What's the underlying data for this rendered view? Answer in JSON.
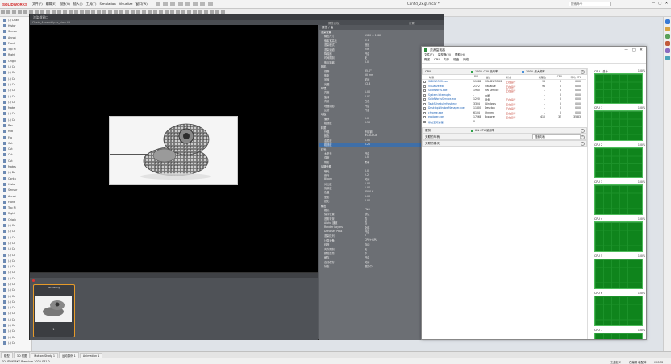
{
  "app": {
    "logo": "SOLIDWORKS",
    "menus": [
      "文件(F)",
      "编辑(E)",
      "视图(V)",
      "插入(I)",
      "工具(T)",
      "Simulation",
      "Visualize",
      "窗口(W)"
    ],
    "doc_title": "Confid_2x.gt.mcar *",
    "search_placeholder": "搜索命令",
    "window_buttons": [
      "—",
      "▢",
      "✕"
    ]
  },
  "tree": {
    "rows": [
      "(-) Chain",
      "Histor",
      "Sensor",
      "Annot",
      "Front",
      "Top Pl",
      "Right",
      "Origin",
      "(-) Co",
      "(-) Co",
      "(-) Co",
      "(-) Co",
      "(-) Co",
      "(-) Co",
      "(-) Co",
      "Mate",
      "(-) Co",
      "(-) Co",
      "Bac",
      "Mid",
      "Fro",
      "Cut",
      "Cut",
      "Cut",
      "Cut",
      "Mates",
      "(-) Ba",
      "Conta",
      "Histor",
      "Sensor",
      "Annot",
      "Front",
      "Top Pl",
      "Right",
      "Origin",
      "(-) Co",
      "(-) Co",
      "(-) Co",
      "(-) Co",
      "(-) Co",
      "(-) Co",
      "(-) Co",
      "(-) Co",
      "(-) Co",
      "(-) Co",
      "(-) Co",
      "(-) Co",
      "(-) Co",
      "(-) Co",
      "(-) Co",
      "(-) Co",
      "(-) Co",
      "(-) Co",
      "(-) Co",
      "(-) Co",
      "(-) Co"
    ]
  },
  "render": {
    "title": "渲染器窗口",
    "tab_left": "Chain_Assembly.xx_view.4d",
    "tab_mid": "属性面板",
    "tab_right": "设置",
    "viewport_hint": "",
    "film_label": "Rendering",
    "film_number": "1"
  },
  "props": {
    "header": "属性 / 值",
    "rows": [
      {
        "k": "渲染设置",
        "v": "",
        "sec": true
      },
      {
        "k": "输出尺寸",
        "v": "1920 × 1080"
      },
      {
        "k": "像素宽高比",
        "v": "1:1"
      },
      {
        "k": "渲染模式",
        "v": "快速"
      },
      {
        "k": "渲染通道",
        "v": "256"
      },
      {
        "k": "降噪器",
        "v": "开启"
      },
      {
        "k": "时间限制",
        "v": "无"
      },
      {
        "k": "焦点距离",
        "v": "0.0"
      },
      {
        "k": "相机",
        "v": "",
        "sec": true
      },
      {
        "k": "视野",
        "v": "35.0°"
      },
      {
        "k": "焦距",
        "v": "50 mm"
      },
      {
        "k": "景深",
        "v": "关闭"
      },
      {
        "k": "光圈",
        "v": "f/2.8"
      },
      {
        "k": "环境",
        "v": "",
        "sec": true
      },
      {
        "k": "亮度",
        "v": "1.00"
      },
      {
        "k": "旋转",
        "v": "0.0°"
      },
      {
        "k": "背景",
        "v": "白色"
      },
      {
        "k": "地面阴影",
        "v": "开启"
      },
      {
        "k": "反射",
        "v": "开启"
      },
      {
        "k": "地板",
        "v": "",
        "sec": true
      },
      {
        "k": "偏移",
        "v": "0.0"
      },
      {
        "k": "粗糙度",
        "v": "0.50"
      },
      {
        "k": "材质",
        "v": "",
        "sec": true
      },
      {
        "k": "外观",
        "v": "不锈钢"
      },
      {
        "k": "颜色",
        "v": "#C8C8C8"
      },
      {
        "k": "金属度",
        "v": "1.00"
      },
      {
        "k": "粗糙度",
        "v": "0.20",
        "sel": true
      },
      {
        "k": "灯光",
        "v": "",
        "sec": true
      },
      {
        "k": "太阳光",
        "v": "开启"
      },
      {
        "k": "强度",
        "v": "1.0"
      },
      {
        "k": "阴影",
        "v": "柔和"
      },
      {
        "k": "后期处理",
        "v": "",
        "sec": true
      },
      {
        "k": "曝光",
        "v": "0.0"
      },
      {
        "k": "伽马",
        "v": "2.2"
      },
      {
        "k": "Bloom",
        "v": "关闭"
      },
      {
        "k": "对比度",
        "v": "1.00"
      },
      {
        "k": "饱和度",
        "v": "1.00"
      },
      {
        "k": "色温",
        "v": "6500 K"
      },
      {
        "k": "晕影",
        "v": "0.00"
      },
      {
        "k": "锐化",
        "v": "0.00"
      },
      {
        "k": "输出",
        "v": "",
        "sec": true
      },
      {
        "k": "格式",
        "v": "PNG"
      },
      {
        "k": "保存位置",
        "v": "默认"
      },
      {
        "k": "透明背景",
        "v": "否"
      },
      {
        "k": "Alpha 通道",
        "v": "否"
      },
      {
        "k": "Render Layers",
        "v": "全部"
      },
      {
        "k": "Denoiser Pass",
        "v": "开启"
      },
      {
        "k": "渲染队列",
        "v": "0"
      },
      {
        "k": "计算设备",
        "v": "CPU+GPU"
      },
      {
        "k": "线程",
        "v": "自动"
      },
      {
        "k": "内存限制",
        "v": "无"
      },
      {
        "k": "预览质量",
        "v": "中"
      },
      {
        "k": "缓存",
        "v": "开启"
      },
      {
        "k": "自动保存",
        "v": "关闭"
      },
      {
        "k": "状态",
        "v": "渲染中"
      }
    ]
  },
  "taskmgr": {
    "title": "资源监视器",
    "menus": [
      "文件(F)",
      "监视器(M)",
      "帮助(H)"
    ],
    "tabs": [
      "概述",
      "CPU",
      "内存",
      "磁盘",
      "网络"
    ],
    "cpu_section": "CPU",
    "cpu_usage": "100% CPU 使用率",
    "cpu_freq": "100% 最大频率",
    "columns": [
      "映像",
      "PID",
      "描述",
      "状态",
      "线程数",
      "CPU",
      "平均 CPU"
    ],
    "processes": [
      {
        "name": "SLDWORKS.exe",
        "pid": "11088",
        "user": "SOLIDWORKS",
        "status": "正在运行",
        "a": "96",
        "b": "0",
        "c": "0.00"
      },
      {
        "name": "Visualize.exe",
        "pid": "2172",
        "user": "Visualize",
        "status": "正在运行",
        "a": "96",
        "b": "0",
        "c": "0.00"
      },
      {
        "name": "SolidWorks.exe",
        "pid": "1980",
        "user": "SW Service",
        "status": "正在运行",
        "a": "-",
        "b": "0",
        "c": "0.00"
      },
      {
        "name": "System Interrupts",
        "pid": "-",
        "user": "中断",
        "status": "-",
        "a": "-",
        "b": "0",
        "c": "0.00"
      },
      {
        "name": "SolidWorksService.exe",
        "pid": "1220",
        "user": "服务",
        "status": "正在运行",
        "a": "-",
        "b": "0",
        "c": "0.00"
      },
      {
        "name": "TaskSchedulerHost.exe",
        "pid": "3304",
        "user": "Windows",
        "status": "正在运行",
        "a": "-",
        "b": "0",
        "c": "0.00"
      },
      {
        "name": "DesktopWindowManager.exe",
        "pid": "11800",
        "user": "Desktop",
        "status": "正在运行",
        "a": "-",
        "b": "0",
        "c": "0.00"
      },
      {
        "name": "chrome.exe",
        "pid": "6104",
        "user": "Chrome",
        "status": "正在运行",
        "a": "-",
        "b": "0",
        "c": "0.00"
      },
      {
        "name": "explorer.exe",
        "pid": "17068",
        "user": "Explorer",
        "status": "正在运行",
        "a": "410",
        "b": "35",
        "c": "35.83"
      },
      {
        "name": "系统空闲进程",
        "pid": "0",
        "user": "-",
        "status": "-",
        "a": "-",
        "b": "-",
        "c": "-"
      }
    ],
    "services_section": "服务",
    "services_usage": "0% CPU 使用率",
    "handles_section": "关联的句柄",
    "handles_filter": "搜索句柄",
    "modules_section": "关联的模块",
    "cpus": [
      {
        "label": "CPU - 总计",
        "pct": "100%",
        "load": 0.98
      },
      {
        "label": "CPU 1",
        "pct": "100%",
        "load": 0.97
      },
      {
        "label": "CPU 2",
        "pct": "100%",
        "load": 0.99
      },
      {
        "label": "CPU 3",
        "pct": "100%",
        "load": 0.96
      },
      {
        "label": "CPU 4",
        "pct": "100%",
        "load": 0.98
      },
      {
        "label": "CPU 5",
        "pct": "100%",
        "load": 0.97
      },
      {
        "label": "CPU 6",
        "pct": "100%",
        "load": 0.99
      },
      {
        "label": "CPU 7",
        "pct": "100%",
        "load": 0.98
      }
    ]
  },
  "bottom": {
    "tabs": [
      "模型",
      "3D 视图",
      "Motion Study 1",
      "运动算例 1",
      "Animation 1"
    ],
    "status_left": "SOLIDWORKS Premium 2022 SP1.0",
    "status_right": [
      "完全定义",
      "在编辑 装配体",
      "MMGS"
    ]
  },
  "colors": {
    "accent": "#e59a2a",
    "cpu_green": "#117a1e",
    "brand_red": "#d02020"
  }
}
